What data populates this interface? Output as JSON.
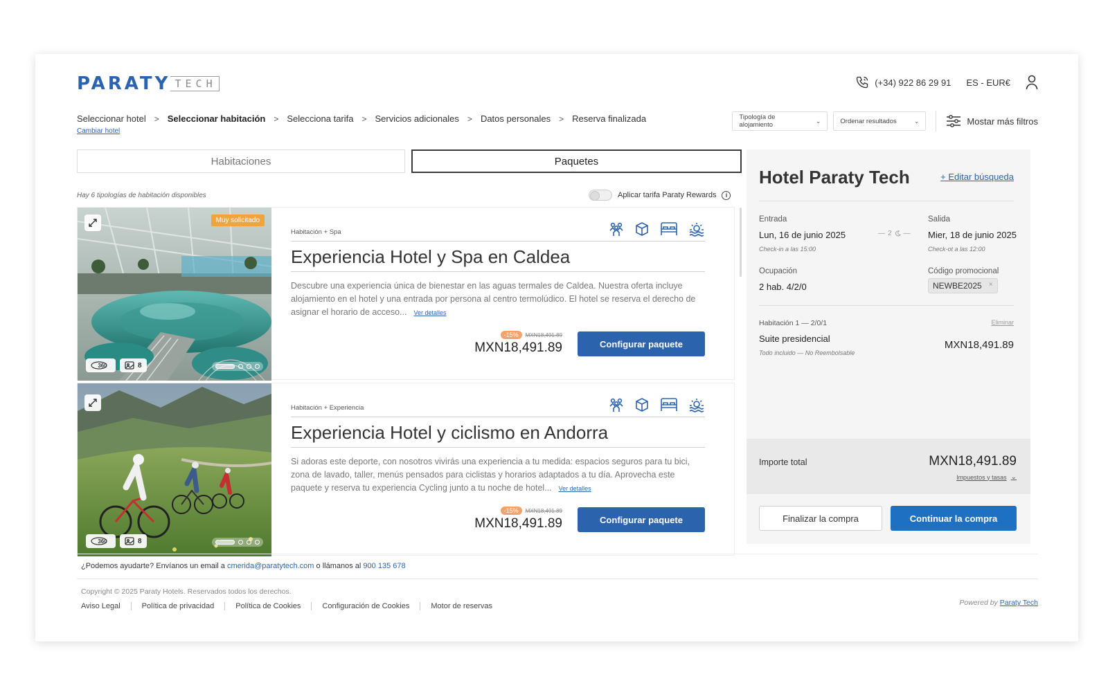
{
  "header": {
    "logo_main": "PARATY",
    "logo_sub": "TECH",
    "phone": "(+34) 922 86 29 91",
    "language": "ES - EUR€"
  },
  "breadcrumb": {
    "steps": [
      "Seleccionar hotel",
      "Seleccionar habitación",
      "Selecciona tarifa",
      "Servicios adicionales",
      "Datos personales",
      "Reserva finalizada"
    ],
    "change_hotel": "Cambiar hotel"
  },
  "filters": {
    "type_select": "Tipología de alojamiento",
    "sort_select": "Ordenar resultados",
    "more_filters": "Mostar más filtros"
  },
  "tabs": {
    "rooms": "Habitaciones",
    "packages": "Paquetes"
  },
  "availability_text": "Hay 6 tipologías de habitación disponibles",
  "rewards_label": "Aplicar tarifa Paraty Rewards",
  "cards": [
    {
      "badge": "Muy solicitado",
      "type": "Habitación + Spa",
      "title": "Experiencia Hotel y Spa en Caldea",
      "description": "Descubre una experiencia única de bienestar en las aguas termales de Caldea. Nuestra oferta incluye alojamiento en el hotel y una entrada por persona al centro termolúdico. El hotel se reserva el derecho de asignar el horario de acceso...",
      "more": "Ver detalles",
      "discount": "-15%",
      "old_price": "MXN18,491.89",
      "price": "MXN18,491.89",
      "button": "Configurar paquete",
      "tour": "360",
      "photos": "8"
    },
    {
      "type": "Habitación + Experiencia",
      "title": "Experiencia Hotel y ciclismo en Andorra",
      "description": "Si adoras este deporte, con nosotros vivirás una experiencia a tu medida: espacios seguros para tu bici, zona de lavado, taller, menús pensados para ciclistas y horarios adaptados a tu día. Aprovecha este paquete y reserva tu experiencia Cycling junto a tu noche de hotel...",
      "more": "Ver detalles",
      "discount": "-15%",
      "old_price": "MXN18,491.89",
      "price": "MXN18,491.89",
      "button": "Configurar paquete",
      "tour": "360",
      "photos": "8"
    }
  ],
  "summary": {
    "hotel": "Hotel Paraty Tech",
    "edit": "+ Editar búsqueda",
    "checkin_label": "Entrada",
    "checkin_value": "Lun, 16 de junio 2025",
    "checkin_note": "Check-in a las 15:00",
    "nights": "2",
    "checkout_label": "Salida",
    "checkout_value": "Mier, 18 de junio 2025",
    "checkout_note": "Check-ot a las 12:00",
    "occupancy_label": "Ocupación",
    "occupancy_value": "2 hab. 4/2/0",
    "promo_label": "Código promocional",
    "promo_code": "NEWBE2025",
    "promo_remove": "×",
    "room_label": "Habitación 1 — 2/0/1",
    "remove": "Eliminar",
    "room_name": "Suite presidencial",
    "room_note": "Todo incluido — No Reembolsable",
    "room_price": "MXN18,491.89",
    "total_label": "Importe total",
    "total_value": "MXN18,491.89",
    "taxes": "Impuestos y tasas",
    "finish": "Finalizar la compra",
    "continue": "Continuar la compra"
  },
  "footer": {
    "help_prefix": "¿Podemos ayudarte? Envíanos un email a",
    "email": "cmerida@paratytech.com",
    "help_middle": "o llámanos al",
    "phone": "900 135 678",
    "copyright": "Copyright © 2025 Paraty Hotels. Reservados todos los derechos.",
    "links": [
      "Aviso Legal",
      "Política de privacidad",
      "Política de Cookies",
      "Configuración de Cookies",
      "Motor de reservas"
    ],
    "powered_prefix": "Powered by",
    "powered_link": "Paraty Tech"
  },
  "colors": {
    "brand_blue": "#2c63ad",
    "primary_button": "#1e70c2",
    "badge_orange": "#f0a53c",
    "discount_orange": "#f3a26b"
  },
  "icons": [
    "phone-icon",
    "user-icon",
    "filters-icon",
    "expand-icon",
    "tour-360-icon",
    "gallery-icon",
    "people-icon",
    "box-icon",
    "bed-icon",
    "spa-icon",
    "moon-icon",
    "info-icon",
    "chevron-down-icon"
  ]
}
